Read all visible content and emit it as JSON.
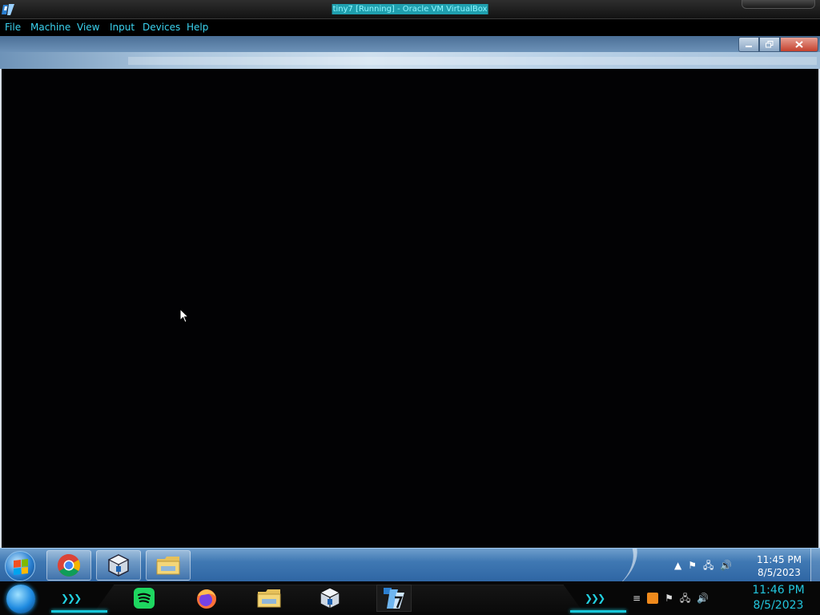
{
  "host": {
    "window_title": "tiny7 [Running] - Oracle VM VirtualBox",
    "menu": [
      "File",
      "Machine",
      "View",
      "Input",
      "Devices",
      "Help"
    ]
  },
  "guest": {
    "window_controls": [
      "minimize-icon",
      "restore-icon",
      "close-icon"
    ],
    "taskbar": {
      "pinned": [
        "chrome-icon",
        "virtualbox-icon",
        "folder-icon"
      ],
      "tray_icons": [
        "show-hidden-icons-icon",
        "action-center-flag-icon",
        "network-icon",
        "volume-icon"
      ],
      "time": "11:45 PM",
      "date": "8/5/2023"
    }
  },
  "host_taskbar": {
    "apps": [
      "spotify-icon",
      "firefox-icon",
      "file-explorer-icon",
      "virtualbox-icon",
      "virtualbox-vm-tiny7-icon"
    ],
    "tray_icons": [
      "keyboard-icon",
      "orange-app-icon",
      "flag-icon",
      "network-icon",
      "volume-icon"
    ],
    "time": "11:46 PM",
    "date": "8/5/2023"
  },
  "colors": {
    "accent_cyan": "#22c6de",
    "guest_taskbar": "#3f78b3",
    "host_taskbar": "#070707"
  }
}
